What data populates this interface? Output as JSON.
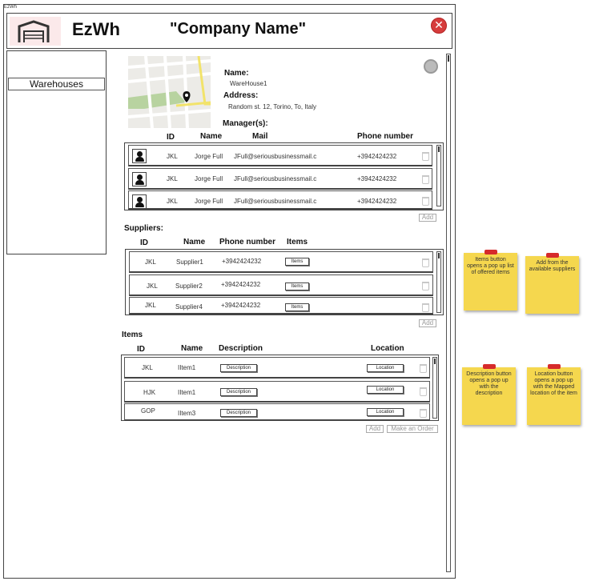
{
  "window": {
    "title": "EzWh"
  },
  "header": {
    "brand": "EzWh",
    "company": "\"Company Name\"",
    "close_glyph": "✕"
  },
  "sidebar": {
    "items": [
      {
        "label": "Warehouses"
      }
    ]
  },
  "warehouse": {
    "name_label": "Name:",
    "name_value": "WareHouse1",
    "address_label": "Address:",
    "address_value": "Random st. 12, Torino, To, Italy",
    "managers_label": "Manager(s):"
  },
  "managers": {
    "headers": {
      "id": "ID",
      "name": "Name",
      "mail": "Mail",
      "phone": "Phone number"
    },
    "rows": [
      {
        "id": "JKL",
        "name": "Jorge Full",
        "mail": "JFull@seriousbusinessmail.c",
        "phone": "+3942424232"
      },
      {
        "id": "JKL",
        "name": "Jorge Full",
        "mail": "JFull@seriousbusinessmail.c",
        "phone": "+3942424232"
      },
      {
        "id": "JKL",
        "name": "Jorge Full",
        "mail": "JFull@seriousbusinessmail.c",
        "phone": "+3942424232"
      }
    ],
    "add_label": "Add"
  },
  "suppliers": {
    "title": "Suppliers:",
    "headers": {
      "id": "ID",
      "name": "Name",
      "phone": "Phone number",
      "items": "Items"
    },
    "rows": [
      {
        "id": "JKL",
        "name": "Supplier1",
        "phone": "+3942424232",
        "items_btn": "Items"
      },
      {
        "id": "JKL",
        "name": "Supplier2",
        "phone": "+3942424232",
        "items_btn": "Items"
      },
      {
        "id": "JKL",
        "name": "Supplier4",
        "phone": "+3942424232",
        "items_btn": "Items"
      }
    ],
    "add_label": "Add"
  },
  "items": {
    "title": "Items",
    "headers": {
      "id": "ID",
      "name": "Name",
      "description": "Description",
      "location": "Location"
    },
    "rows": [
      {
        "id": "JKL",
        "name": "IItem1",
        "desc_btn": "Description",
        "loc_btn": "Location"
      },
      {
        "id": "HJK",
        "name": "IItem1",
        "desc_btn": "Description",
        "loc_btn": "Location"
      },
      {
        "id": "GOP",
        "name": "IItem3",
        "desc_btn": "Description",
        "loc_btn": "Location"
      }
    ],
    "add_label": "Add",
    "order_label": "Make an Order"
  },
  "notes": [
    {
      "text": "Items button opens a pop up list of offered items"
    },
    {
      "text": "Add from the available suppliers"
    },
    {
      "text": "Description button opens a pop up with the description"
    },
    {
      "text": "Location button opens a pop up with the Mapped location of the item"
    }
  ],
  "colors": {
    "sticky": "#f5d74e",
    "close": "#d63c3c",
    "map_park": "#b8d3a0",
    "map_road": "#f2e36a"
  }
}
